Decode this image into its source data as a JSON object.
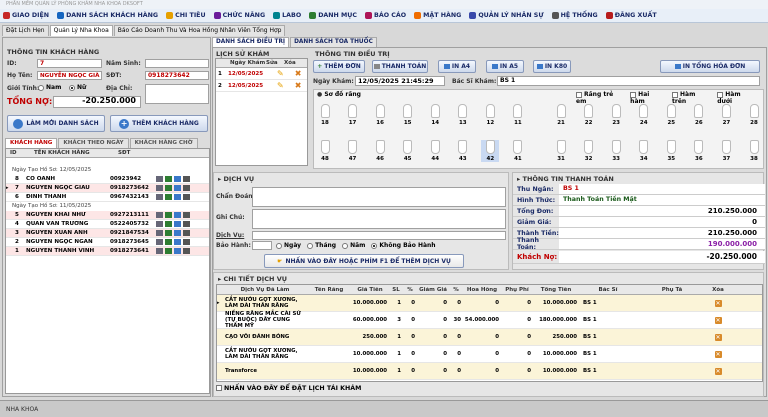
{
  "window": {
    "title": "PHẦN MỀM QUẢN LÝ PHÒNG KHÁM NHA KHOA DKSOFT"
  },
  "menu": [
    {
      "label": "GIAO DIỆN",
      "color": "#c62828"
    },
    {
      "label": "DANH SÁCH KHÁCH HÀNG",
      "color": "#1565c0"
    },
    {
      "label": "CHI TIÊU",
      "color": "#e6a000"
    },
    {
      "label": "CHỨC NĂNG",
      "color": "#6a1b9a"
    },
    {
      "label": "LABO",
      "color": "#00838f"
    },
    {
      "label": "DANH MỤC",
      "color": "#2e7d32"
    },
    {
      "label": "BÁO CÁO",
      "color": "#ad1457"
    },
    {
      "label": "MẶT HÀNG",
      "color": "#ef6c00"
    },
    {
      "label": "QUẢN LÝ NHÂN SỰ",
      "color": "#3949ab"
    },
    {
      "label": "HỆ THỐNG",
      "color": "#555555"
    },
    {
      "label": "ĐĂNG XUẤT",
      "color": "#b71c1c"
    }
  ],
  "top_tabs": [
    "Đặt Lịch Hẹn",
    "Quản Lý Nha Khoa",
    "Báo Cáo Doanh Thu Và Hoa Hồng Nhân Viên Tổng Hợp"
  ],
  "customer": {
    "section": "THÔNG TIN KHÁCH HÀNG",
    "id_label": "ID:",
    "id": "7",
    "birth_label": "Năm Sinh:",
    "birth": "",
    "name_label": "Họ Tên:",
    "name": "NGUYỄN NGỌC GIÀ",
    "phone_label": "SĐT:",
    "phone": "0918273642",
    "gender_label": "Giới Tính:",
    "male": "Nam",
    "female": "Nữ",
    "address_label": "Địa Chỉ:",
    "debt_label": "TỔNG NỢ:",
    "debt": "-20.250.000",
    "refresh_btn": "LÀM MỚI DANH SÁCH",
    "add_btn": "THÊM KHÁCH HÀNG"
  },
  "cust_tabs": [
    "KHÁCH HÀNG",
    "KHÁCH THEO NGÀY",
    "KHÁCH HÀNG CHỜ"
  ],
  "cust_grid": {
    "headers": [
      "ID",
      "TÊN KHÁCH HÀNG",
      "SĐT"
    ],
    "groups": [
      {
        "label": "Ngày Tạo Hồ Sơ: 12/05/2025",
        "rows": [
          {
            "id": "8",
            "name": "CÔ OANH",
            "phone": "00923942",
            "sel": false,
            "pink": false
          },
          {
            "id": "7",
            "name": "NGUYỄN NGỌC GIÀU",
            "phone": "0918273642",
            "sel": true,
            "pink": true
          },
          {
            "id": "6",
            "name": "ĐINH THANH",
            "phone": "0967432143",
            "sel": false,
            "pink": false
          }
        ]
      },
      {
        "label": "Ngày Tạo Hồ Sơ: 11/05/2025",
        "rows": [
          {
            "id": "5",
            "name": "NGUYỄN KHẢI NHƯ",
            "phone": "0927213111",
            "sel": false,
            "pink": true
          },
          {
            "id": "4",
            "name": "QUAN VĂN TRƯỜNG",
            "phone": "0522405732",
            "sel": false,
            "pink": false
          },
          {
            "id": "3",
            "name": "NGUYỄN XUÂN ANH",
            "phone": "0921847534",
            "sel": false,
            "pink": true
          },
          {
            "id": "2",
            "name": "NGUYỄN NGỌC NGAN",
            "phone": "0918273645",
            "sel": false,
            "pink": false
          },
          {
            "id": "1",
            "name": "NGUYỄN THANH VINH",
            "phone": "0918273641",
            "sel": false,
            "pink": true
          }
        ]
      }
    ]
  },
  "mid_tabs": [
    "DANH SÁCH ĐIỀU TRỊ",
    "DANH SÁCH TOA THUỐC"
  ],
  "history": {
    "section": "LỊCH SỬ KHÁM",
    "headers": [
      "Ngày Khám",
      "Sửa",
      "Xóa"
    ],
    "rows": [
      "12/05/2025",
      "12/05/2025"
    ]
  },
  "treatment": {
    "section": "THÔNG TIN ĐIỀU TRỊ",
    "btn_add": "THÊM ĐƠN",
    "btn_pay": "THANH TOÁN",
    "btn_a4": "IN A4",
    "btn_a5": "IN A5",
    "btn_k80": "IN K80",
    "btn_print_all": "IN TỔNG HÓA ĐƠN",
    "date_label": "Ngày Khám:",
    "date": "12/05/2025 21:45:29",
    "doctor_label": "Bác Sĩ Khám:",
    "doctor": "BS 1"
  },
  "teeth": {
    "section": "Sơ đồ răng",
    "options": [
      "Răng trẻ em",
      "Hai hàm",
      "Hàm trên",
      "Hàm dưới"
    ],
    "upper": [
      "18",
      "17",
      "16",
      "15",
      "14",
      "13",
      "12",
      "11",
      "21",
      "22",
      "23",
      "24",
      "25",
      "26",
      "27",
      "28"
    ],
    "lower": [
      "48",
      "47",
      "46",
      "45",
      "44",
      "43",
      "42",
      "41",
      "31",
      "32",
      "33",
      "34",
      "35",
      "36",
      "37",
      "38"
    ]
  },
  "service": {
    "section": "DỊCH VỤ",
    "diagnosis_label": "Chẩn Đoán:",
    "note_label": "Ghi Chú:",
    "service_label": "Dịch Vụ:",
    "warranty_label": "Bảo Hành:",
    "warranty_opts": [
      "Ngày",
      "Tháng",
      "Năm",
      "Không Bảo Hành"
    ],
    "hint": "NHẤN VÀO ĐÂY HOẶC PHÍM F1 ĐỂ THÊM DỊCH VỤ"
  },
  "payment": {
    "section": "THÔNG TIN THANH TOÁN",
    "cashier_label": "Thu Ngân:",
    "cashier": "BS 1",
    "method_label": "Hình Thức:",
    "method": "Thanh Toán Tiền Mặt",
    "total_label": "Tổng Đơn:",
    "total": "210.250.000",
    "discount_label": "Giảm Giá:",
    "discount": "0",
    "amount_label": "Thành Tiền:",
    "amount": "210.250.000",
    "paid_label": "Thanh Toán:",
    "paid": "190.000.000",
    "debt_label": "Khách Nợ:",
    "debt": "-20.250.000"
  },
  "detail": {
    "section": "CHI TIẾT DỊCH VỤ",
    "headers": [
      "Dịch Vụ Đã Làm",
      "Tên Răng",
      "Giá Tiền",
      "SL",
      "%",
      "Giảm Giá",
      "%",
      "Hoa Hồng",
      "Phụ Phí",
      "Tổng Tiền",
      "Bác Sĩ",
      "Phụ Tá",
      "Xóa"
    ],
    "rows": [
      {
        "svc": "CẮT NƯỚU GỌT XƯƠNG, LÀM DÀI THÂN RĂNG",
        "tooth": "",
        "price": "10.000.000",
        "qty": "1",
        "p1": "0",
        "disc": "0",
        "p2": "0",
        "comm": "0",
        "fee": "0",
        "total": "10.000.000",
        "doc": "BS 1",
        "asst": ""
      },
      {
        "svc": "NIỀNG RĂNG MẮC CÀI SỨ (TỰ BUỘC) DÂY CUNG THẨM MỸ",
        "tooth": "",
        "price": "60.000.000",
        "qty": "3",
        "p1": "0",
        "disc": "0",
        "p2": "30",
        "comm": "54.000.000",
        "fee": "0",
        "total": "180.000.000",
        "doc": "BS 1",
        "asst": ""
      },
      {
        "svc": "CẠO VÔI ĐÁNH BÓNG",
        "tooth": "",
        "price": "250.000",
        "qty": "1",
        "p1": "0",
        "disc": "0",
        "p2": "0",
        "comm": "0",
        "fee": "0",
        "total": "250.000",
        "doc": "BS 1",
        "asst": ""
      },
      {
        "svc": "CẮT NƯỚU GỌT XƯƠNG, LÀM DÀI THÂN RĂNG",
        "tooth": "",
        "price": "10.000.000",
        "qty": "1",
        "p1": "0",
        "disc": "0",
        "p2": "0",
        "comm": "0",
        "fee": "0",
        "total": "10.000.000",
        "doc": "BS 1",
        "asst": ""
      },
      {
        "svc": "Transforce",
        "tooth": "",
        "price": "10.000.000",
        "qty": "1",
        "p1": "0",
        "disc": "0",
        "p2": "0",
        "comm": "0",
        "fee": "0",
        "total": "10.000.000",
        "doc": "BS 1",
        "asst": ""
      }
    ],
    "footer_hint": "NHẤN VÀO ĐÂY ĐỂ ĐẶT LỊCH TÁI KHÁM"
  },
  "status": {
    "text": "NHA KHOA"
  }
}
